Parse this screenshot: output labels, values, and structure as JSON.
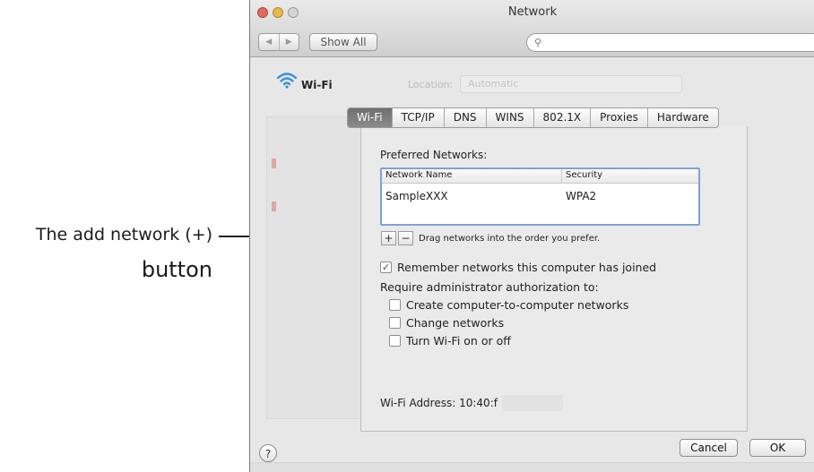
{
  "annotation": {
    "line1": "The add network (+)",
    "line2": "button"
  },
  "window": {
    "title": "Network",
    "show_all": "Show All",
    "nav_back": "◀",
    "nav_forward": "▶",
    "search_placeholder": ""
  },
  "header": {
    "interface_name": "Wi-Fi",
    "location_label": "Location:",
    "location_value": "Automatic"
  },
  "tabs": [
    {
      "label": "Wi-Fi",
      "active": true
    },
    {
      "label": "TCP/IP",
      "active": false
    },
    {
      "label": "DNS",
      "active": false
    },
    {
      "label": "WINS",
      "active": false
    },
    {
      "label": "802.1X",
      "active": false
    },
    {
      "label": "Proxies",
      "active": false
    },
    {
      "label": "Hardware",
      "active": false
    }
  ],
  "preferred": {
    "label": "Preferred Networks:",
    "columns": [
      "Network Name",
      "Security"
    ],
    "rows": [
      [
        "SampleXXX",
        "WPA2"
      ]
    ],
    "add_label": "+",
    "remove_label": "−",
    "hint": "Drag networks into the order you prefer."
  },
  "options": {
    "remember": {
      "label": "Remember networks this computer has joined",
      "checked": true
    },
    "require_label": "Require administrator authorization to:",
    "items": [
      {
        "label": "Create computer-to-computer networks",
        "checked": false
      },
      {
        "label": "Change networks",
        "checked": false
      },
      {
        "label": "Turn Wi-Fi on or off",
        "checked": false
      }
    ]
  },
  "wifi_address": {
    "label": "Wi-Fi Address:",
    "value": "10:40:f"
  },
  "footer": {
    "help": "?",
    "cancel": "Cancel",
    "ok": "OK"
  },
  "colors": {
    "selection_blue": "#7aa3d9",
    "wifi_icon": "#3b8fe0",
    "check_mark": "#2b4f9a"
  }
}
